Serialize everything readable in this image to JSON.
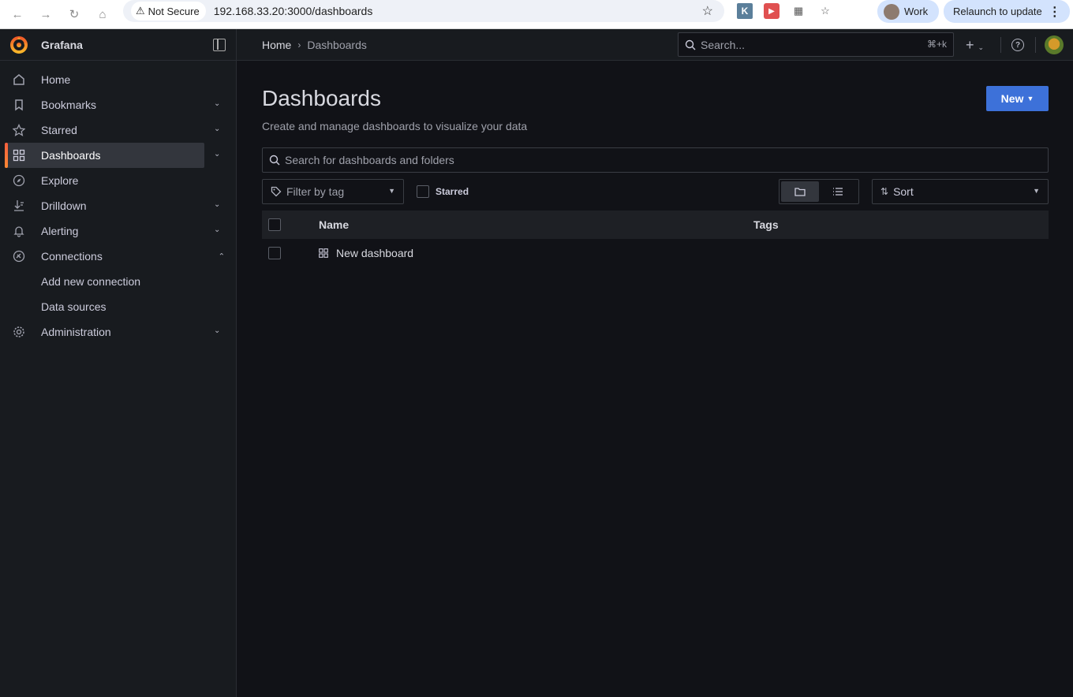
{
  "browser": {
    "security_label": "Not Secure",
    "url": "192.168.33.20:3000/dashboards",
    "profile_label": "Work",
    "relaunch_label": "Relaunch to update"
  },
  "sidebar": {
    "brand": "Grafana",
    "items": [
      {
        "label": "Home",
        "icon": "home-icon",
        "expandable": false
      },
      {
        "label": "Bookmarks",
        "icon": "bookmark-icon",
        "expandable": true
      },
      {
        "label": "Starred",
        "icon": "star-icon",
        "expandable": true
      },
      {
        "label": "Dashboards",
        "icon": "apps-icon",
        "expandable": true,
        "active": true
      },
      {
        "label": "Explore",
        "icon": "compass-icon",
        "expandable": false
      },
      {
        "label": "Drilldown",
        "icon": "drilldown-icon",
        "expandable": true
      },
      {
        "label": "Alerting",
        "icon": "bell-icon",
        "expandable": true
      },
      {
        "label": "Connections",
        "icon": "connections-icon",
        "expandable": true,
        "expanded": true
      },
      {
        "label": "Administration",
        "icon": "cog-icon",
        "expandable": true
      }
    ],
    "connections_children": [
      "Add new connection",
      "Data sources"
    ]
  },
  "topbar": {
    "breadcrumb_home": "Home",
    "breadcrumb_current": "Dashboards",
    "search_placeholder": "Search...",
    "search_shortcut": "⌘+k"
  },
  "main": {
    "title": "Dashboards",
    "subtitle": "Create and manage dashboards to visualize your data",
    "new_button": "New",
    "search_placeholder": "Search for dashboards and folders",
    "tag_filter_label": "Filter by tag",
    "starred_label": "Starred",
    "sort_label": "Sort",
    "columns": {
      "name": "Name",
      "tags": "Tags"
    },
    "rows": [
      {
        "name": "New dashboard",
        "tags": ""
      }
    ]
  },
  "colors": {
    "accent_blue": "#3d71d9",
    "active_indicator": "#f55f3e",
    "background": "#111217",
    "sidebar_bg": "#181b1f"
  }
}
